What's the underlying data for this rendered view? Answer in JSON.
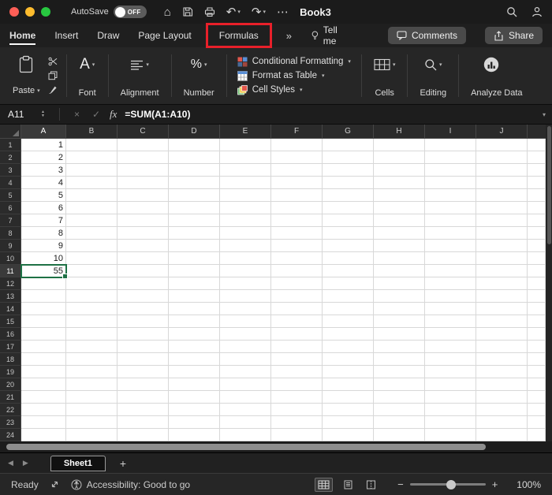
{
  "titlebar": {
    "autosave_label": "AutoSave",
    "autosave_state": "OFF",
    "document_title": "Book3"
  },
  "tabs": {
    "home": "Home",
    "insert": "Insert",
    "draw": "Draw",
    "page_layout": "Page Layout",
    "formulas": "Formulas",
    "tell_me": "Tell me"
  },
  "top_buttons": {
    "comments": "Comments",
    "share": "Share"
  },
  "ribbon": {
    "paste": "Paste",
    "font": "Font",
    "alignment": "Alignment",
    "number": "Number",
    "conditional_formatting": "Conditional Formatting",
    "format_as_table": "Format as Table",
    "cell_styles": "Cell Styles",
    "cells": "Cells",
    "editing": "Editing",
    "analyze_data": "Analyze Data",
    "font_icon_letter": "A",
    "number_icon": "%"
  },
  "formula_bar": {
    "name_box": "A11",
    "fx_label": "fx",
    "formula": "=SUM(A1:A10)"
  },
  "grid": {
    "selected_cell": "A11",
    "columns": [
      "A",
      "B",
      "C",
      "D",
      "E",
      "F",
      "G",
      "H",
      "I",
      "J"
    ],
    "row_count": 24,
    "column_a_values": {
      "1": "1",
      "2": "2",
      "3": "3",
      "4": "4",
      "5": "5",
      "6": "6",
      "7": "7",
      "8": "8",
      "9": "9",
      "10": "10",
      "11": "55"
    }
  },
  "sheet_bar": {
    "active_sheet": "Sheet1",
    "add_sheet_label": "+"
  },
  "status_bar": {
    "mode": "Ready",
    "accessibility": "Accessibility: Good to go",
    "zoom_out": "−",
    "zoom_in": "+",
    "zoom_level": "100%"
  },
  "icons": {
    "home": "⌂",
    "undo": "↶",
    "redo": "↷",
    "more": "⋯",
    "chevron_down": "▾",
    "chevrons_overflow": "»",
    "cancel": "×",
    "confirm": "✓",
    "stepper_up": "▲",
    "stepper_down": "▼",
    "prev_sheet": "◀",
    "next_sheet": "▶"
  },
  "colors": {
    "selection_green": "#1E7145",
    "highlight_red": "#E8202A"
  }
}
